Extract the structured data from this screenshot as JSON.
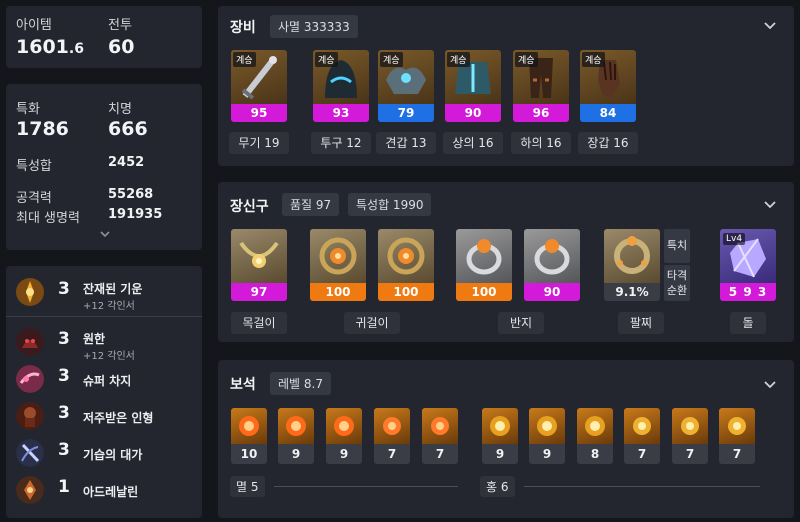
{
  "left": {
    "stats1": {
      "item_label": "아이템",
      "item_value_main": "1601",
      "item_value_dec": ".6",
      "combat_label": "전투",
      "combat_value": "60"
    },
    "stats2": {
      "spec_label": "특화",
      "spec_value": "1786",
      "crit_label": "치명",
      "crit_value": "666",
      "total_label": "특성합",
      "total_value": "2452",
      "atk_label": "공격력",
      "atk_value": "55268",
      "hp_label": "최대 생명력",
      "hp_value": "191935"
    },
    "engravings": [
      {
        "level": "3",
        "name": "잔재된 기운",
        "sub": "+12 각인서",
        "icon": "residual-energy-icon"
      },
      {
        "level": "3",
        "name": "원한",
        "sub": "+12 각인서",
        "icon": "grudge-icon"
      },
      {
        "level": "3",
        "name": "슈퍼 차지",
        "sub": "",
        "icon": "super-charge-icon"
      },
      {
        "level": "3",
        "name": "저주받은 인형",
        "sub": "",
        "icon": "cursed-doll-icon"
      },
      {
        "level": "3",
        "name": "기습의 대가",
        "sub": "",
        "icon": "master-ambush-icon"
      },
      {
        "level": "1",
        "name": "아드레날린",
        "sub": "",
        "icon": "adrenaline-icon"
      }
    ]
  },
  "equipment": {
    "title": "장비",
    "badge": "사멸 333333",
    "items": [
      {
        "tag": "계승",
        "quality": "95",
        "name": "무기 19",
        "color": "#d21ad8",
        "icon": "weapon-icon"
      },
      {
        "tag": "계승",
        "quality": "93",
        "name": "투구 12",
        "color": "#d21ad8",
        "icon": "helmet-icon"
      },
      {
        "tag": "계승",
        "quality": "79",
        "name": "견갑 13",
        "color": "#1f6fe5",
        "icon": "shoulder-icon"
      },
      {
        "tag": "계승",
        "quality": "90",
        "name": "상의 16",
        "color": "#d21ad8",
        "icon": "chest-icon"
      },
      {
        "tag": "계승",
        "quality": "96",
        "name": "하의 16",
        "color": "#d21ad8",
        "icon": "pants-icon"
      },
      {
        "tag": "계승",
        "quality": "84",
        "name": "장갑 16",
        "color": "#1f6fe5",
        "icon": "gloves-icon"
      }
    ]
  },
  "accessories": {
    "title": "장신구",
    "badge_quality": "품질 97",
    "badge_total": "특성합 1990",
    "necklace": {
      "quality": "97",
      "color": "#d21ad8",
      "name": "목걸이",
      "icon": "necklace-icon"
    },
    "earrings": [
      {
        "quality": "100",
        "color": "#f07a12",
        "icon": "earring-icon"
      },
      {
        "quality": "100",
        "color": "#f07a12",
        "icon": "earring-icon"
      }
    ],
    "earrings_name": "귀걸이",
    "rings": [
      {
        "quality": "100",
        "color": "#f07a12",
        "icon": "ring-icon"
      },
      {
        "quality": "90",
        "color": "#d21ad8",
        "icon": "ring-icon"
      }
    ],
    "rings_name": "반지",
    "bracelet": {
      "value": "9.1%",
      "name": "팔찌",
      "stat1": "특치",
      "stat2_line1": "타격",
      "stat2_line2": "순환",
      "icon": "bracelet-icon"
    },
    "stone": {
      "level": "Lv4",
      "value": "5 9 3",
      "name": "돌",
      "color": "#d21ad8",
      "icon": "ability-stone-icon"
    }
  },
  "gems": {
    "title": "보석",
    "badge": "레벨 8.7",
    "annihilation": [
      "10",
      "9",
      "9",
      "7",
      "7"
    ],
    "annihilation_label": "멸 5",
    "crimson": [
      "9",
      "9",
      "8",
      "7",
      "7",
      "7"
    ],
    "crimson_label": "홍 6"
  }
}
